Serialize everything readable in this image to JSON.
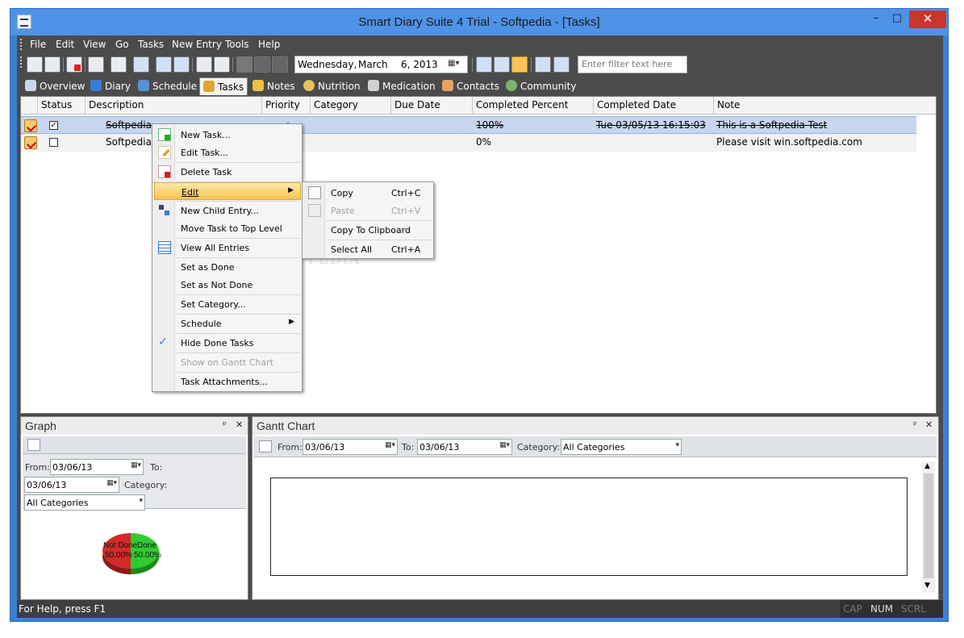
{
  "window": {
    "title": "Smart Diary Suite 4 Trial - Softpedia - [Tasks]",
    "caption_buttons": {
      "minimize": "–",
      "maximize": "□",
      "close": "✕"
    }
  },
  "menubar": [
    "File",
    "Edit",
    "View",
    "Go",
    "Tasks",
    "New Entry",
    "Tools",
    "Help"
  ],
  "toolbar": {
    "date": {
      "weekday": "Wednesday,",
      "month": "March",
      "day_year": "6, 2013"
    },
    "filter_placeholder": "Enter filter text here"
  },
  "tabs": [
    {
      "label": "Overview",
      "icon": "overview-icon",
      "color": "#c9d7ea"
    },
    {
      "label": "Diary",
      "icon": "diary-icon",
      "color": "#3a7bd5"
    },
    {
      "label": "Schedule",
      "icon": "schedule-icon",
      "color": "#5b8fd6"
    },
    {
      "label": "Tasks",
      "icon": "tasks-icon",
      "color": "#e0a532"
    },
    {
      "label": "Notes",
      "icon": "notes-icon",
      "color": "#f0c040"
    },
    {
      "label": "Nutrition",
      "icon": "nutrition-icon",
      "color": "#e6c15a"
    },
    {
      "label": "Medication",
      "icon": "medication-icon",
      "color": "#d0d0d0"
    },
    {
      "label": "Contacts",
      "icon": "contacts-icon",
      "color": "#e4a460"
    },
    {
      "label": "Community",
      "icon": "community-icon",
      "color": "#7fb36a"
    }
  ],
  "grid": {
    "columns": [
      "Status",
      "Description",
      "Priority",
      "Category",
      "Due Date",
      "Completed Percent",
      "Completed Date",
      "Note"
    ],
    "rows": [
      {
        "status": "✓",
        "description": "Softpedia",
        "priority": "✓",
        "completed_percent": "100%",
        "completed_date": "Tue 03/05/13 16:15:03",
        "note": "This is a Softpedia Test"
      },
      {
        "status": "",
        "description": "Softpedia T",
        "completed_percent": "0%",
        "note": "Please visit win.softpedia.com"
      }
    ]
  },
  "watermark": "SOFTPEDIA",
  "context_menu": {
    "new_task": "New Task...",
    "edit_task": "Edit Task...",
    "delete_task": "Delete Task",
    "edit": "Edit",
    "new_child": "New Child Entry...",
    "move_top": "Move Task to Top Level",
    "view_all": "View All Entries",
    "set_done": "Set as Done",
    "set_not_done": "Set as Not Done",
    "set_category": "Set Category...",
    "schedule": "Schedule",
    "hide_done": "Hide Done Tasks",
    "show_gantt": "Show on Gantt Chart",
    "attachments": "Task Attachments..."
  },
  "edit_submenu": {
    "copy": "Copy",
    "copy_short": "Ctrl+C",
    "paste": "Paste",
    "paste_short": "Ctrl+V",
    "copy_clipboard": "Copy To Clipboard",
    "select_all": "Select All",
    "select_all_short": "Ctrl+A"
  },
  "graph_pane": {
    "title": "Graph",
    "pin": "ᵖ",
    "close": "✕",
    "from_label": "From:",
    "from_value": "03/06/13",
    "to_label": "To:",
    "to_value": "03/06/13",
    "category_label": "Category:",
    "category_value": "All Categories"
  },
  "pie": {
    "slices": [
      {
        "label": "Not Done",
        "percent": "50.00%",
        "value": 50,
        "color": "#d42a2a"
      },
      {
        "label": "Done",
        "percent": "50.00%",
        "value": 50,
        "color": "#2ecc2e"
      }
    ]
  },
  "gantt_pane": {
    "title": "Gantt Chart",
    "pin": "ᵖ",
    "close": "✕",
    "from_label": "From:",
    "from_value": "03/06/13",
    "to_label": "To:",
    "to_value": "03/06/13",
    "category_label": "Category:",
    "category_value": "All Categories"
  },
  "statusbar": {
    "help": "For Help, press F1",
    "cap": "CAP",
    "num": "NUM",
    "scrl": "SCRL"
  }
}
